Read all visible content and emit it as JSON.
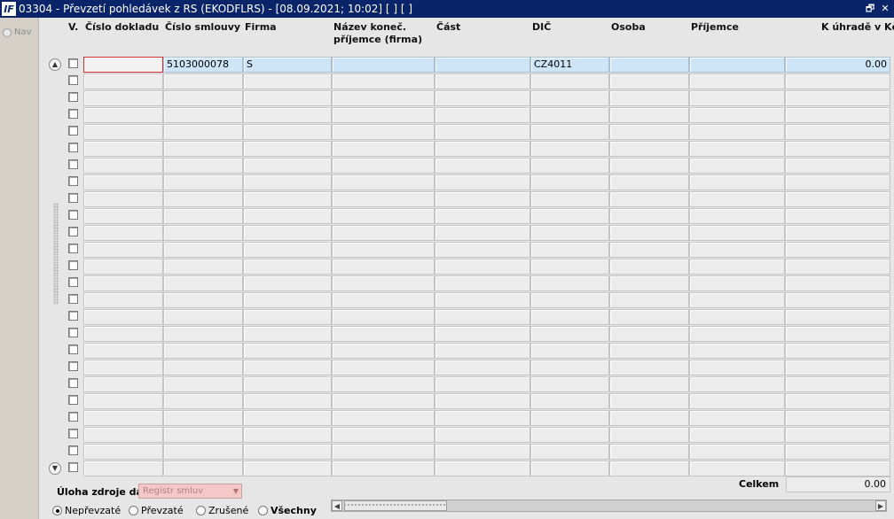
{
  "window": {
    "icon_text": "IF",
    "title": "03304 - Převzetí pohledávek z RS (EKODFLRS) - [08.09.2021; 10:02]  [ ] [ ]",
    "restore_glyph": "🗗",
    "close_glyph": "✕"
  },
  "nav": {
    "label": "Nav"
  },
  "table": {
    "headers": {
      "v": "V.",
      "cislo_dokladu": "Číslo dokladu",
      "cislo_smlouvy": "Číslo smlouvy",
      "firma": "Firma",
      "nazev_konec_1": "Název koneč.",
      "nazev_konec_2": "příjemce (firma)",
      "cast": "Část",
      "dic": "DIČ",
      "osoba": "Osoba",
      "prijemce": "Příjemce",
      "k_uhrade": "K úhradě v Kč"
    },
    "first_row": {
      "cislo_dokladu": "",
      "cislo_smlouvy": "5103000078",
      "firma": "S",
      "nazev": "",
      "cast": "",
      "dic": "CZ4011",
      "osoba": "",
      "prijemce": "",
      "k_uhrade": "0.00"
    }
  },
  "footer": {
    "uloha_label": "Úloha zdroje dat",
    "uloha_value": "Registr smluv",
    "celkem_label": "Celkem",
    "celkem_value": "0.00",
    "radios": [
      {
        "label": "Nepřevzaté",
        "selected": true
      },
      {
        "label": "Převzaté",
        "selected": false
      },
      {
        "label": "Zrušené",
        "selected": false
      },
      {
        "label": "Všechny",
        "selected": false
      }
    ]
  },
  "colors": {
    "titlebar": "#0a246a",
    "highlight_cell": "#cde5f7",
    "focus_border": "#d23030",
    "readonly_field": "#f5c8c8"
  }
}
